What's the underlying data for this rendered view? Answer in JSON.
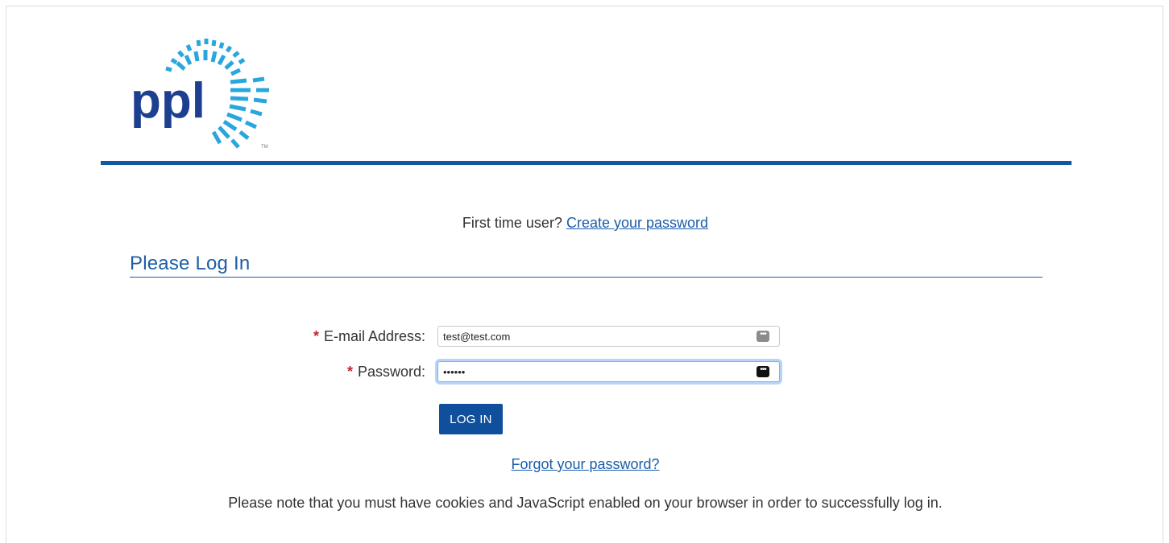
{
  "brand": {
    "logo_text": "ppl",
    "trademark": "TM",
    "primary_color": "#1157a6",
    "logo_text_color": "#1d3f8f",
    "ray_color": "#2aa6de"
  },
  "intro": {
    "prompt": "First time user?",
    "create_password_link": "Create your password"
  },
  "login": {
    "title": "Please Log In",
    "email": {
      "required_mark": "*",
      "label": "E-mail Address:",
      "value": "test@test.com"
    },
    "password": {
      "required_mark": "*",
      "label": "Password:",
      "value": "••••••"
    },
    "submit_label": "LOG IN",
    "forgot_link": "Forgot your password?"
  },
  "notice": "Please note that you must have cookies and JavaScript enabled on your browser in order to successfully log in.",
  "icons": {
    "email_autofill": "password-manager-key-icon",
    "password_autofill": "password-manager-key-icon"
  }
}
